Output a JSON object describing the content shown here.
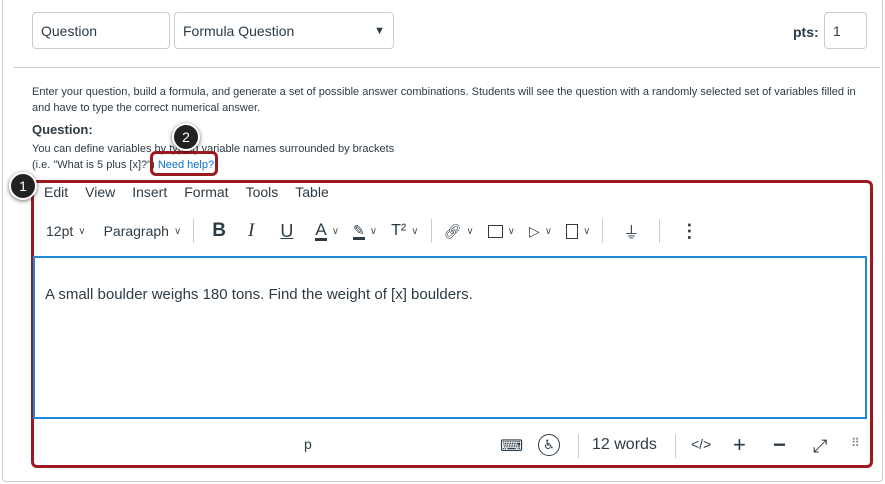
{
  "header": {
    "question_name": "Question",
    "question_type": "Formula Question",
    "points_label": "pts:",
    "points_value": "1"
  },
  "description": "Enter your question, build a formula, and generate a set of possible answer combinations. Students will see the question with a randomly selected set of variables filled in and have to type the correct numerical answer.",
  "question_heading": "Question:",
  "help_line1": "You can define variables by typing variable names surrounded by brackets",
  "help_line2": "(i.e. \"What is 5 plus [x]?\")",
  "need_help": "Need help?",
  "badges": [
    "1",
    "2"
  ],
  "menu": [
    "Edit",
    "View",
    "Insert",
    "Format",
    "Tools",
    "Table"
  ],
  "toolbar": {
    "font_size": "12pt",
    "block": "Paragraph",
    "bold": "B",
    "italic": "I",
    "underline": "U",
    "text_color": "A",
    "superscript": "T²",
    "more": "⋮"
  },
  "editor_content": "A small boulder weighs 180 tons. Find the weight of [x] boulders.",
  "status": {
    "path": "p",
    "word_count": "12 words",
    "html_toggle": "</>"
  },
  "colors": {
    "highlight": "#9b1a1f",
    "link": "#0a74c9",
    "focus": "#1f88d9"
  }
}
